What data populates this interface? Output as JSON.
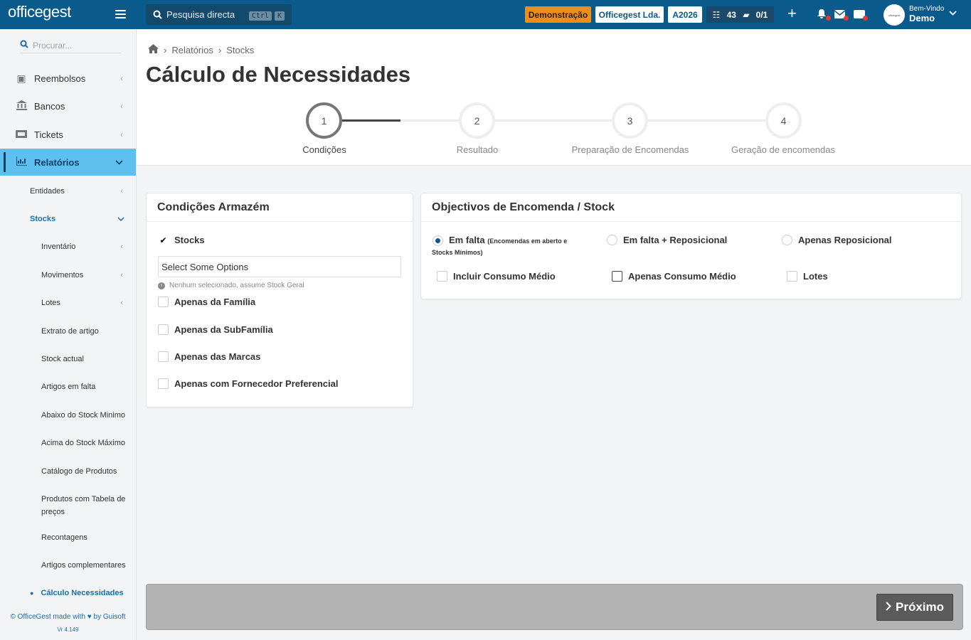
{
  "topbar": {
    "logo": "officegest",
    "search_placeholder": "Pesquisa directa",
    "kbd1": "Ctrl",
    "kbd2": "K",
    "demo": "Demonstração",
    "company": "Officegest Lda.",
    "year": "A2026",
    "tasks_count": "43",
    "docs_count": "0/1",
    "welcome": "Bem-Vindo",
    "user": "Demo"
  },
  "sidebar": {
    "search_placeholder": "Procurar...",
    "items": [
      {
        "label": "Reembolsos",
        "icon": "money-icon"
      },
      {
        "label": "Bancos",
        "icon": "bank-icon"
      },
      {
        "label": "Tickets",
        "icon": "ticket-icon"
      },
      {
        "label": "Relatórios",
        "icon": "chart-icon"
      }
    ],
    "sub": {
      "entidades": "Entidades",
      "stocks": "Stocks",
      "inventario": "Inventário",
      "movimentos": "Movimentos",
      "lotes": "Lotes",
      "extrato": "Extrato de artigo",
      "stock_actual": "Stock actual",
      "artigos_falta": "Artigos em falta",
      "abaixo": "Abaixo do Stock Minimo",
      "acima": "Acima do Stock Máximo",
      "catalogo": "Catálogo de Produtos",
      "tabela1": "Produtos com Tabela de",
      "tabela2": "preços",
      "recontagens": "Recontagens",
      "complementares": "Artigos complementares",
      "calculo": "Cálculo Necessidades"
    },
    "footer": "© OfficeGest made with",
    "footer_by": "by Guisoft",
    "version": "Vr 4.149"
  },
  "breadcrumb": {
    "item1": "Relatórios",
    "item2": "Stocks"
  },
  "page_title": "Cálculo de Necessidades",
  "steps": [
    {
      "num": "1",
      "label": "Condições"
    },
    {
      "num": "2",
      "label": "Resultado"
    },
    {
      "num": "3",
      "label": "Preparação de Encomendas"
    },
    {
      "num": "4",
      "label": "Geração de encomendas"
    }
  ],
  "card_left": {
    "title": "Condições Armazém",
    "stocks": "Stocks",
    "select": "Select Some Options",
    "hint": "Nenhum selecionado, assume Stock Geral",
    "familia": "Apenas da Família",
    "subfamilia": "Apenas da SubFamília",
    "marcas": "Apenas das Marcas",
    "fornecedor": "Apenas com Fornecedor Preferencial"
  },
  "card_right": {
    "title": "Objectivos de Encomenda / Stock",
    "r1": "Em falta",
    "r1_note1": "(Encomendas em aberto e",
    "r1_note2": "Stocks Mínimos)",
    "r2": "Em falta + Reposicional",
    "r3": "Apenas Reposicional",
    "c1": "Incluir Consumo Médio",
    "c2": "Apenas Consumo Médio",
    "c3": "Lotes"
  },
  "next_label": "Próximo"
}
